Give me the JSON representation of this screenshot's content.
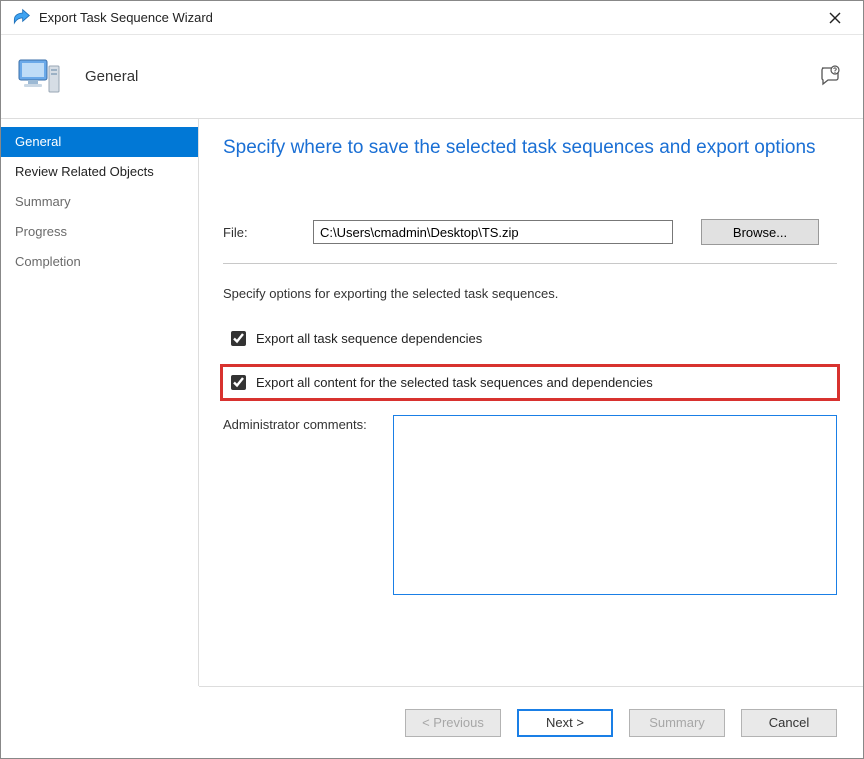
{
  "window": {
    "title": "Export Task Sequence Wizard"
  },
  "header": {
    "label": "General"
  },
  "sidebar": {
    "steps": [
      {
        "label": "General",
        "state": "active"
      },
      {
        "label": "Review Related Objects",
        "state": "enabled"
      },
      {
        "label": "Summary",
        "state": "disabled"
      },
      {
        "label": "Progress",
        "state": "disabled"
      },
      {
        "label": "Completion",
        "state": "disabled"
      }
    ]
  },
  "main": {
    "heading": "Specify where to save the selected task sequences and export options",
    "file_label": "File:",
    "file_value": "C:\\Users\\cmadmin\\Desktop\\TS.zip",
    "browse_label": "Browse...",
    "options_intro": "Specify options for exporting the selected task sequences.",
    "checkbox1_label": "Export all task sequence dependencies",
    "checkbox1_checked": true,
    "checkbox2_label": "Export all content for the selected task sequences and dependencies",
    "checkbox2_checked": true,
    "comments_label": "Administrator comments:",
    "comments_value": ""
  },
  "footer": {
    "previous": "< Previous",
    "next": "Next >",
    "summary": "Summary",
    "cancel": "Cancel"
  },
  "icons": {
    "title_arrow": "export-arrow-icon",
    "wizard": "computer-monitor-icon",
    "help": "help-speech-icon",
    "close": "close-icon"
  }
}
